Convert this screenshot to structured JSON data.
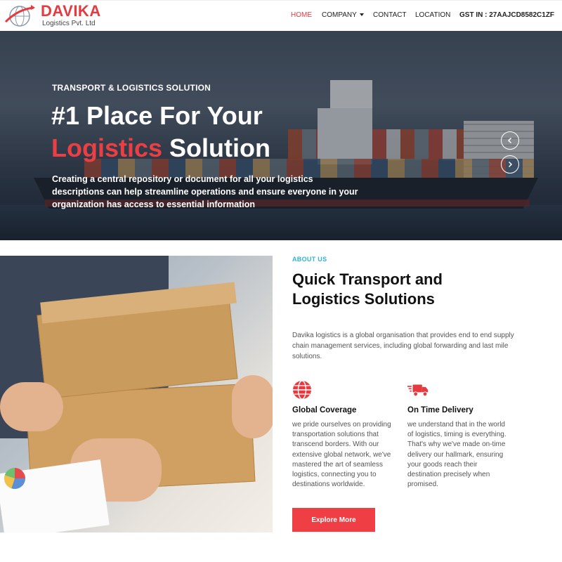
{
  "brand": {
    "name": "DAVIKA",
    "subtitle": "Logistics Pvt. Ltd",
    "logo_icon": "globe-swoosh-logo"
  },
  "nav": {
    "home": "HOME",
    "company": "COMPANY",
    "contact": "CONTACT",
    "location": "LOCATION",
    "gst": "GST IN : 27AAJCD8582C1ZF",
    "active": "HOME"
  },
  "hero": {
    "kicker": "TRANSPORT & LOGISTICS SOLUTION",
    "title_line1": "#1 Place For Your",
    "title_accent": "Logistics",
    "title_rest": " Solution",
    "description": "Creating a central repository or document for all your logistics descriptions can help streamline operations and ensure everyone in your organization has access to essential information",
    "prev_icon": "chevron-left-icon",
    "next_icon": "chevron-right-icon"
  },
  "about": {
    "kicker": "ABOUT US",
    "title": "Quick Transport and Logistics Solutions",
    "description": "Davika logistics is a global organisation that provides end to end supply chain management services, including global forwarding and last mile solutions.",
    "features": [
      {
        "icon": "globe-icon",
        "title": "Global Coverage",
        "text": "we pride ourselves on providing transportation solutions that transcend borders. With our extensive global network, we've mastered the art of seamless logistics, connecting you to destinations worldwide."
      },
      {
        "icon": "fast-truck-icon",
        "title": "On Time Delivery",
        "text": "we understand that in the world of logistics, timing is everything. That's why we've made on-time delivery our hallmark, ensuring your goods reach their destination precisely when promised."
      }
    ],
    "cta": "Explore More"
  },
  "colors": {
    "accent": "#f03f44",
    "kicker_blue": "#2fb3d6",
    "text_dark": "#111111"
  }
}
